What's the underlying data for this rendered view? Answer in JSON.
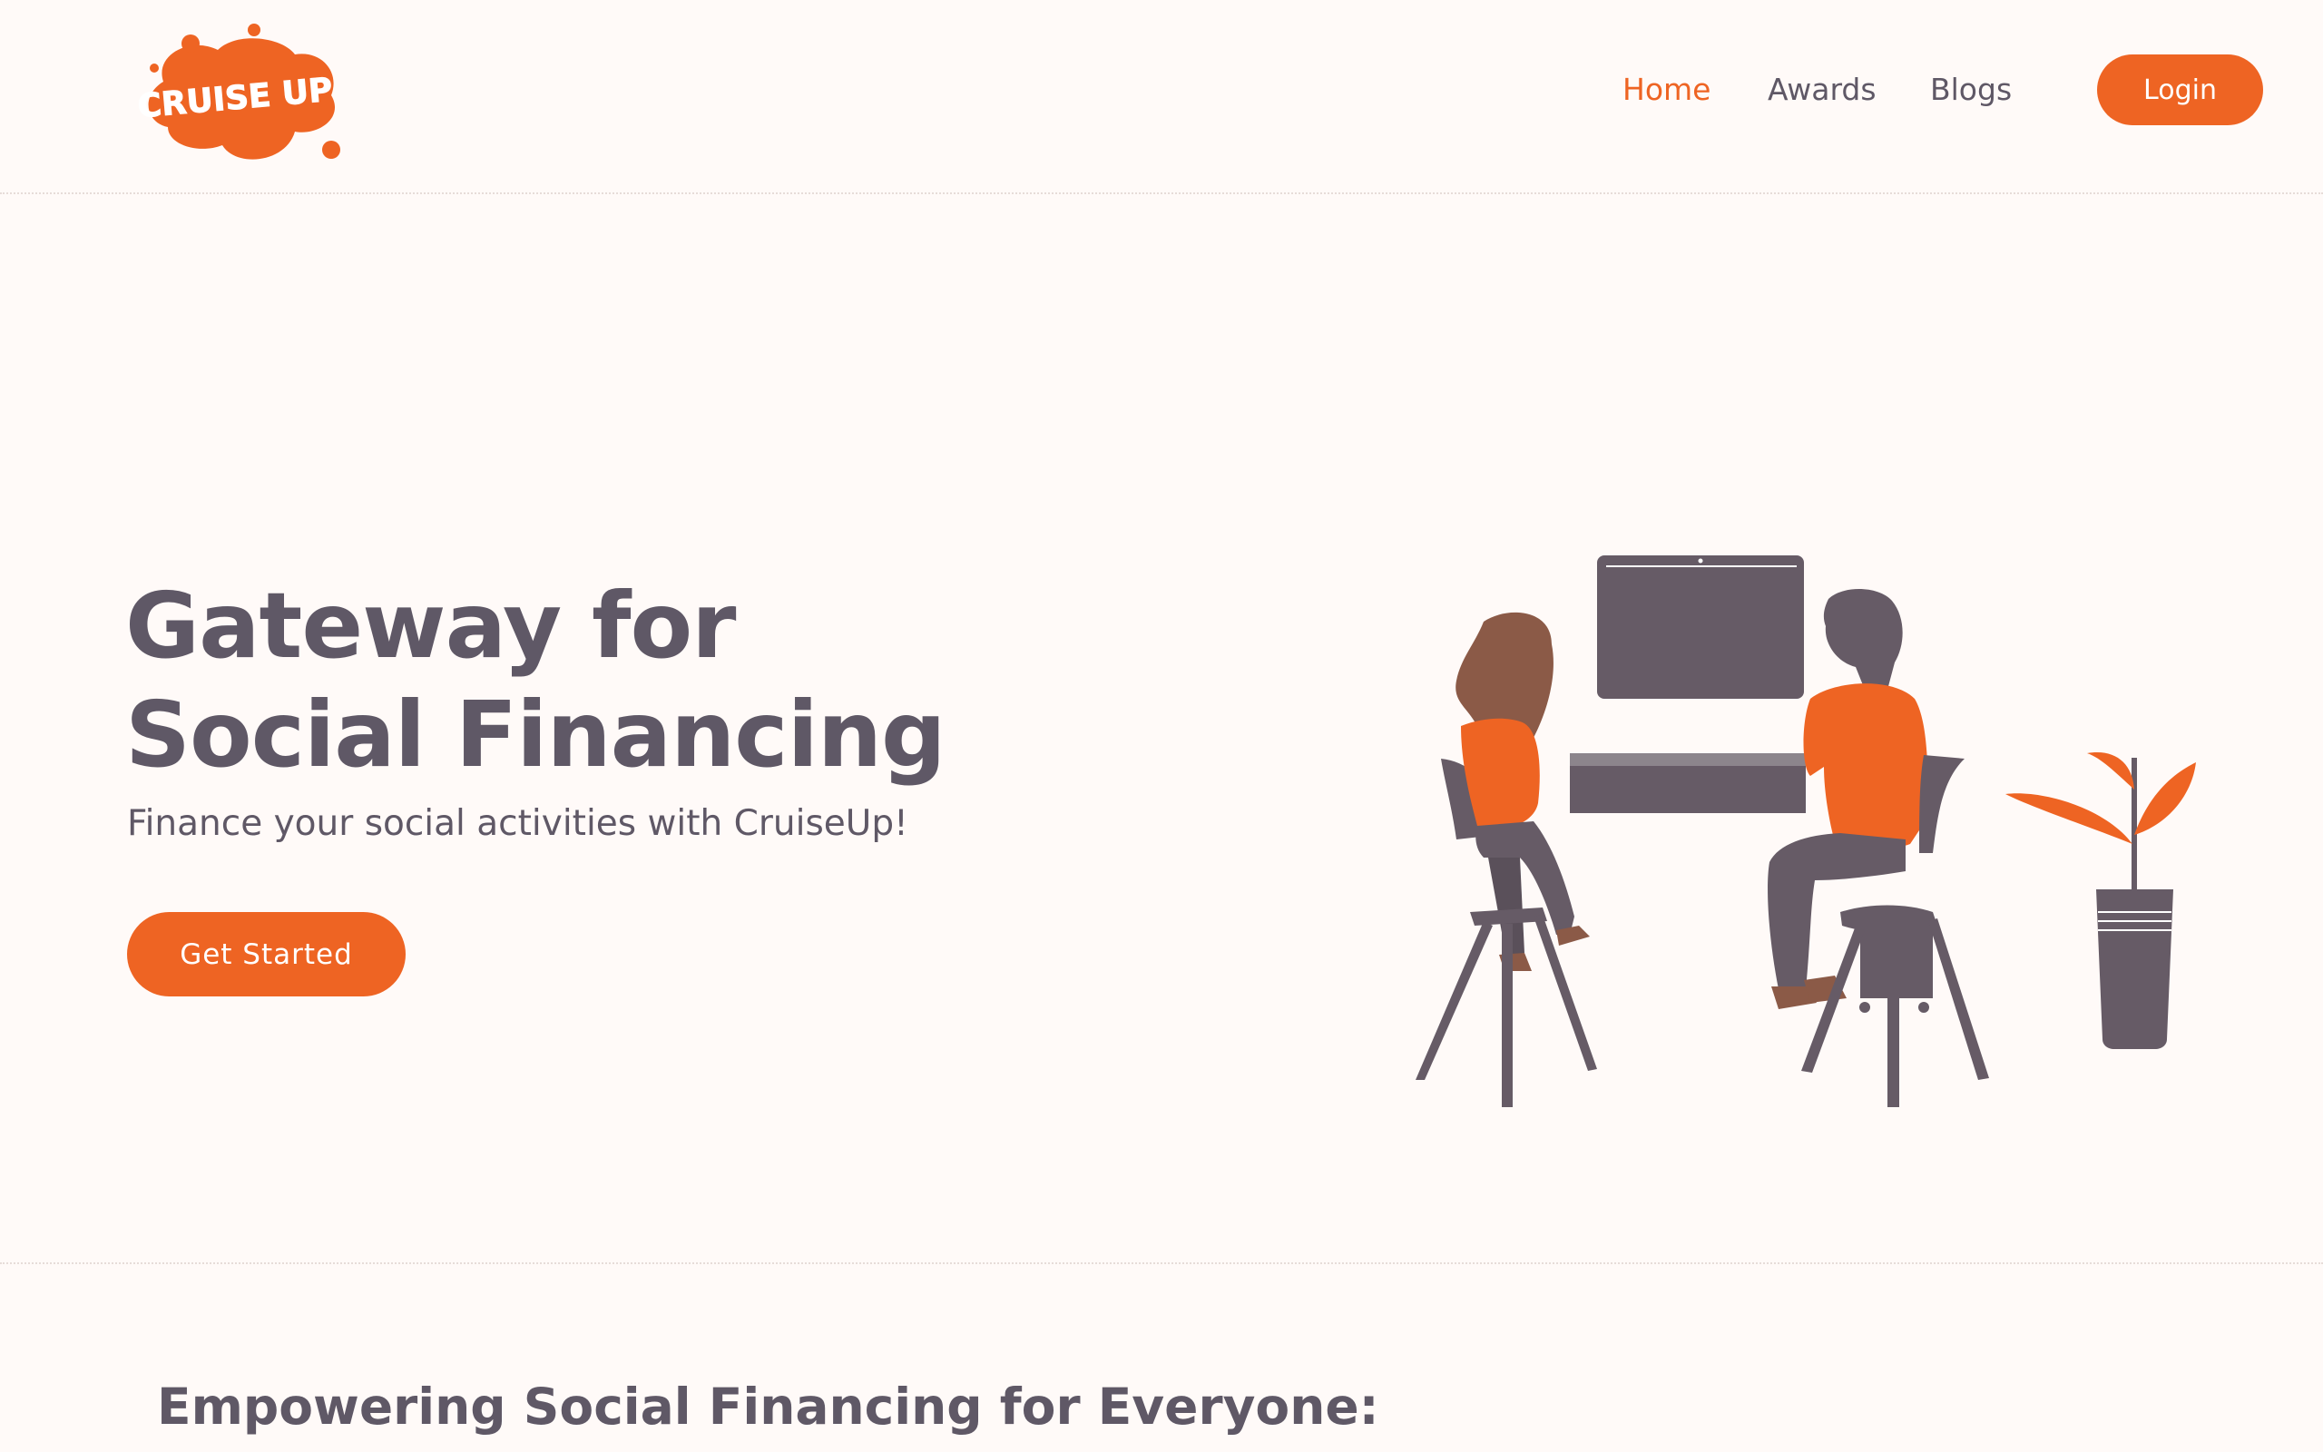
{
  "brand": {
    "logo_text": "CRUISE UP",
    "accent_color": "#EE6423",
    "text_color": "#5F5866",
    "background_color": "#FFFAF8"
  },
  "nav": {
    "items": [
      {
        "label": "Home",
        "active": true
      },
      {
        "label": "Awards",
        "active": false
      },
      {
        "label": "Blogs",
        "active": false
      }
    ],
    "login_label": "Login"
  },
  "hero": {
    "title": "Gateway for Social Financing",
    "subtitle": "Finance your social activities with CruiseUp!",
    "cta_label": "Get Started",
    "illustration": "two-people-at-computer-illustration"
  },
  "section": {
    "title": "Empowering Social Financing for Everyone:"
  }
}
